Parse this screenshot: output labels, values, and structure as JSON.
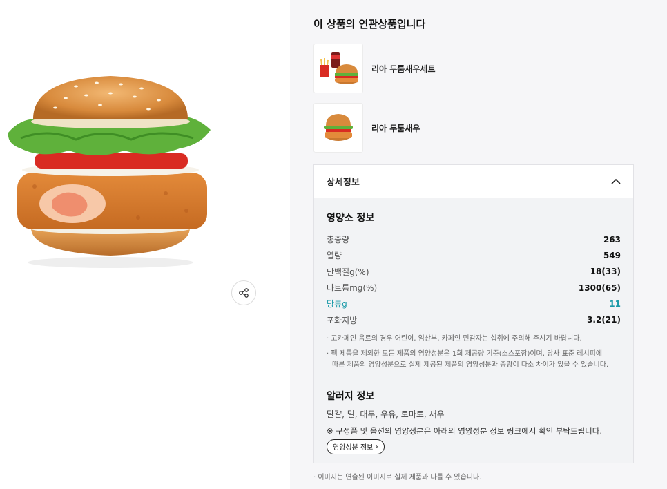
{
  "related": {
    "title": "이 상품의 연관상품입니다",
    "items": [
      {
        "name": "리아 두툼새우세트",
        "icon": "burger-set-thumbnail"
      },
      {
        "name": "리아 두툼새우",
        "icon": "burger-thumbnail"
      }
    ]
  },
  "share": {
    "icon": "share-icon"
  },
  "detail": {
    "header": "상세정보",
    "toggle_icon": "chevron-up-icon",
    "nutrition": {
      "heading": "영양소 정보",
      "rows": [
        {
          "label": "총중량",
          "value": "263"
        },
        {
          "label": "열량",
          "value": "549"
        },
        {
          "label": "단백질g(%)",
          "value": "18(33)"
        },
        {
          "label": "나트륨mg(%)",
          "value": "1300(65)"
        },
        {
          "label": "당류g",
          "value": "11"
        },
        {
          "label": "포화지방",
          "value": "3.2(21)"
        }
      ],
      "notice1": "· 고카페인 음료의 경우 어린이, 임산부, 카페인 민감자는 섭취에 주의해 주시기 바랍니다.",
      "notice2a": "· 팩 제품을 제외한 모든 제품의 영양성분은 1회 제공량 기준(소스포함)이며, 당사 표준 레시피에",
      "notice2b": "따른 제품의 영양성분으로 실제 제공된 제품의 영양성분과 중량이 다소 차이가 있을 수 있습니다."
    },
    "allergy": {
      "heading": "알러지 정보",
      "text": "달걀, 밀, 대두, 우유, 토마토, 새우",
      "note": "※ 구성품 및 옵션의 영양성분은 아래의 영양성분 정보 링크에서 확인 부탁드립니다.",
      "link_label": "영양성분 정보"
    }
  },
  "footer": {
    "disclaimer": "· 이미지는 연출된 이미지로 실제 제품과 다를 수 있습니다."
  },
  "colors": {
    "highlight": "#1a9aa8",
    "panel_bg": "#f6f6f8"
  }
}
